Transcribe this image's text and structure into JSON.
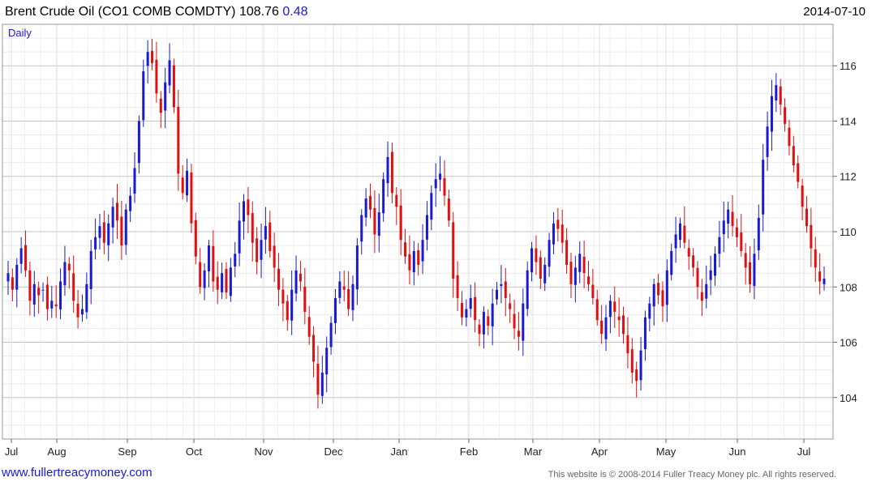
{
  "header": {
    "name": "Brent Crude Oil",
    "ticker": "(CO1 COMB COMDTY)",
    "price": "108.76",
    "change": "0.48",
    "date": "2014-07-10"
  },
  "footer": {
    "website": "www.fullertreacymoney.com",
    "copyright": "This website is © 2008-2014 Fuller Treacy Money plc. All rights reserved."
  },
  "colors": {
    "up": "#1a1ad0",
    "down": "#e01010",
    "grid": "#d8d8d8"
  },
  "chart_data": {
    "type": "candlestick",
    "label": "Daily",
    "y_axis_position": "right",
    "ylim": [
      102.5,
      117.5
    ],
    "y_ticks": [
      104,
      106,
      108,
      110,
      112,
      114,
      116
    ],
    "x_ticks": [
      "Jul",
      "Aug",
      "Sep",
      "Oct",
      "Nov",
      "Dec",
      "Jan",
      "Feb",
      "Mar",
      "Apr",
      "May",
      "Jun",
      "Jul"
    ],
    "grid": true,
    "closes": [
      108.5,
      107.9,
      108.8,
      109.4,
      108.6,
      107.5,
      108.1,
      107.7,
      107.9,
      107.2,
      107.5,
      107.3,
      108.2,
      108.9,
      108.6,
      107.5,
      106.9,
      107.2,
      108.1,
      109.3,
      109.8,
      110.2,
      109.6,
      110.3,
      110.9,
      110.4,
      109.5,
      110.8,
      111.3,
      112.3,
      114.0,
      115.8,
      116.5,
      116.1,
      115.0,
      114.3,
      115.4,
      116.2,
      114.5,
      112.1,
      111.4,
      112.2,
      110.3,
      109.1,
      108.0,
      108.6,
      109.5,
      108.2,
      107.9,
      108.5,
      107.8,
      108.7,
      109.2,
      110.4,
      111.1,
      110.6,
      109.6,
      108.9,
      109.7,
      110.2,
      109.3,
      108.7,
      107.9,
      107.4,
      106.8,
      107.9,
      108.6,
      108.2,
      107.1,
      106.2,
      105.3,
      104.1,
      104.9,
      105.8,
      106.7,
      107.6,
      108.2,
      107.9,
      107.2,
      108.1,
      109.5,
      110.6,
      111.2,
      110.8,
      109.9,
      110.7,
      111.9,
      112.7,
      111.4,
      110.9,
      109.7,
      109.1,
      108.6,
      109.3,
      108.8,
      109.7,
      110.6,
      111.4,
      111.9,
      112.1,
      111.3,
      110.4,
      108.3,
      107.6,
      106.9,
      107.2,
      107.6,
      106.8,
      106.3,
      107.1,
      106.6,
      107.4,
      107.9,
      108.1,
      107.6,
      107.2,
      106.5,
      106.2,
      107.4,
      108.6,
      109.4,
      108.9,
      108.3,
      108.8,
      109.7,
      110.3,
      110.1,
      109.6,
      108.8,
      108.1,
      108.7,
      109.2,
      108.5,
      108.1,
      107.6,
      106.8,
      106.3,
      106.9,
      107.5,
      107.1,
      106.8,
      106.3,
      105.6,
      104.9,
      104.6,
      105.7,
      106.9,
      107.4,
      108.1,
      107.7,
      107.3,
      108.6,
      109.3,
      109.9,
      110.3,
      109.6,
      109.1,
      108.7,
      108.0,
      107.5,
      108.1,
      108.6,
      109.2,
      109.8,
      110.4,
      110.8,
      110.2,
      109.8,
      109.3,
      108.7,
      108.1,
      109.2,
      110.5,
      112.6,
      113.8,
      114.9,
      115.3,
      114.6,
      113.9,
      113.1,
      112.4,
      111.8,
      110.9,
      110.2,
      109.4,
      108.7,
      108.2,
      108.3
    ]
  }
}
